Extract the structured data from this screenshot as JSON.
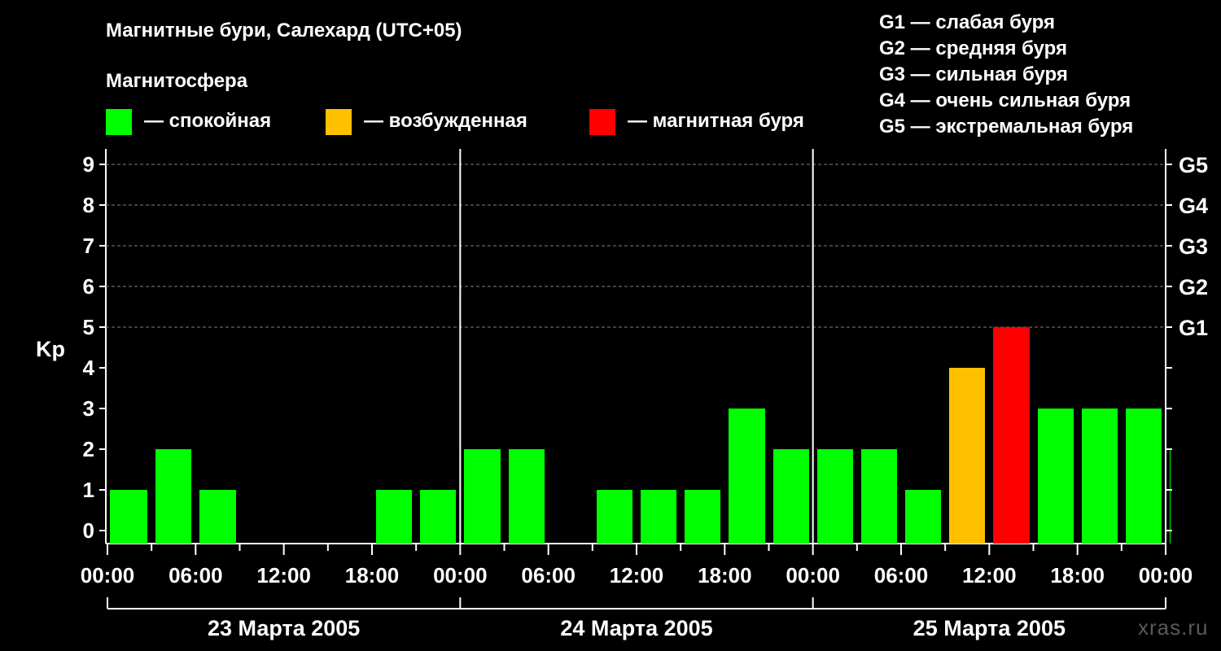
{
  "header": {
    "title": "Магнитные бури, Салехард (UTC+05)",
    "legend_heading": "Магнитосфера",
    "states": [
      {
        "label": "— спокойная",
        "color": "#00ff00"
      },
      {
        "label": "— возбужденная",
        "color": "#ffc000"
      },
      {
        "label": "— магнитная буря",
        "color": "#ff0000"
      }
    ],
    "g_scale": [
      "G1 — слабая буря",
      "G2 — средняя буря",
      "G3 — сильная буря",
      "G4 — очень сильная буря",
      "G5 — экстремальная буря"
    ]
  },
  "watermark": "xras.ru",
  "chart_data": {
    "type": "bar",
    "ylabel": "Kp",
    "ylim": [
      0,
      9
    ],
    "y_ticks": [
      "0",
      "1",
      "2",
      "3",
      "4",
      "5",
      "6",
      "7",
      "8",
      "9"
    ],
    "g_levels": [
      {
        "label": "G1",
        "kp": 5
      },
      {
        "label": "G2",
        "kp": 6
      },
      {
        "label": "G3",
        "kp": 7
      },
      {
        "label": "G4",
        "kp": 8
      },
      {
        "label": "G5",
        "kp": 9
      }
    ],
    "x_tick_labels": [
      "00:00",
      "06:00",
      "12:00",
      "18:00",
      "00:00",
      "06:00",
      "12:00",
      "18:00",
      "00:00",
      "06:00",
      "12:00",
      "18:00",
      "00:00"
    ],
    "days": [
      "23 Марта 2005",
      "24 Марта 2005",
      "25 Марта 2005"
    ],
    "interval_hours": 3,
    "series": [
      {
        "values": [
          1,
          2,
          1,
          0,
          0,
          0,
          1,
          1,
          2,
          2,
          0,
          1,
          1,
          1,
          3,
          2,
          2,
          2,
          1,
          4,
          5,
          3,
          3,
          3,
          2
        ]
      }
    ],
    "colors": {
      "quiet": "#00ff00",
      "active": "#ffc000",
      "storm": "#ff0000"
    },
    "grid": true
  }
}
